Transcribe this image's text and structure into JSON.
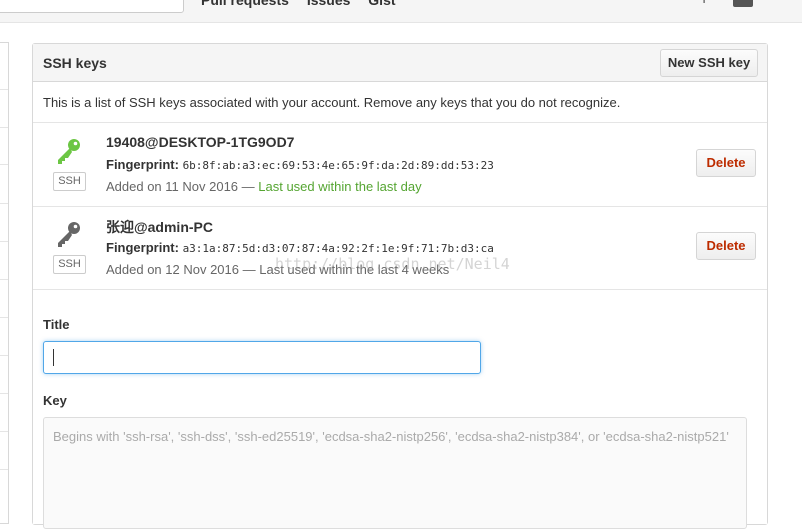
{
  "header": {
    "nav": [
      "Pull requests",
      "Issues",
      "Gist"
    ],
    "plus_icon": "plus-icon"
  },
  "ssh": {
    "title": "SSH keys",
    "new_button": "New SSH key",
    "description": "This is a list of SSH keys associated with your account. Remove any keys that you do not recognize.",
    "keys": [
      {
        "name": "19408@DESKTOP-1TG9OD7",
        "fingerprint_label": "Fingerprint:",
        "fingerprint": "6b:8f:ab:a3:ec:69:53:4e:65:9f:da:2d:89:dd:53:23",
        "added": "Added on 11 Nov 2016",
        "separator": " — ",
        "last_used": "Last used within the last day",
        "type_label": "SSH",
        "icon": "key-icon",
        "icon_color": "#6cc644",
        "delete_label": "Delete"
      },
      {
        "name": "张迎@admin-PC",
        "fingerprint_label": "Fingerprint:",
        "fingerprint": "a3:1a:87:5d:d3:07:87:4a:92:2f:1e:9f:71:7b:d3:ca",
        "added": "Added on 12 Nov 2016",
        "separator": " — ",
        "last_used": "Last used within the last 4 weeks",
        "type_label": "SSH",
        "icon": "key-icon",
        "icon_color": "#666666",
        "delete_label": "Delete"
      }
    ]
  },
  "form": {
    "title_label": "Title",
    "title_value": "",
    "key_label": "Key",
    "key_placeholder": "Begins with 'ssh-rsa', 'ssh-dss', 'ssh-ed25519', 'ecdsa-sha2-nistp256', 'ecdsa-sha2-nistp384', or 'ecdsa-sha2-nistp521'"
  },
  "watermark": "http://blog.csdn.net/Neil4",
  "colors": {
    "delete": "#bd2c00",
    "used_recent": "#55a532",
    "focus_border": "#51a7e8"
  }
}
